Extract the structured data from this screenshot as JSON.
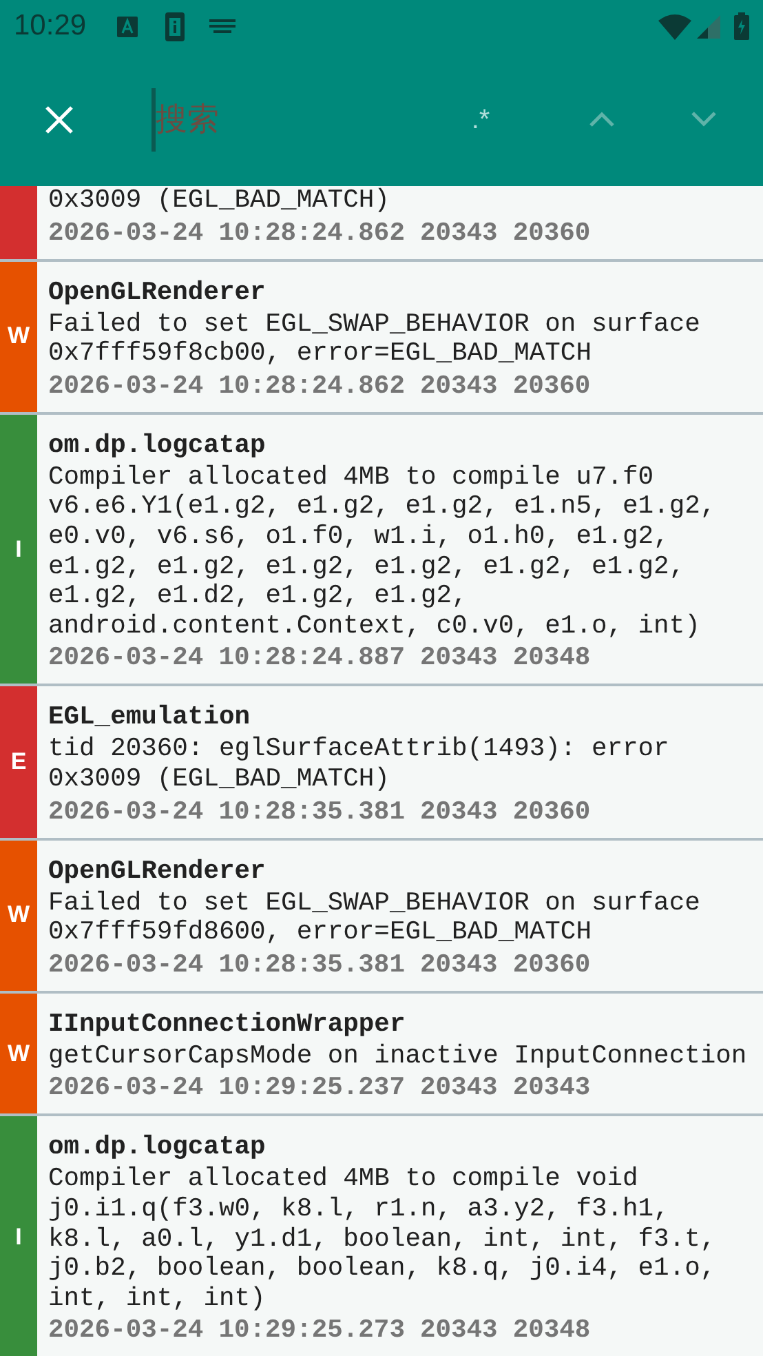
{
  "status_bar": {
    "time": "10:29"
  },
  "search": {
    "placeholder": "搜索",
    "regex_toggle": ".*",
    "prev_disabled": true,
    "next_disabled": true
  },
  "entries": [
    {
      "kind": "error",
      "message": "0x3009 (EGL_BAD_MATCH)",
      "date": "2026-03-24",
      "time": "10:28:24.862",
      "pid": "20343",
      "tid": "20360"
    },
    {
      "kind": "warn",
      "level": "W",
      "tag": "OpenGLRenderer",
      "message": "Failed to set EGL_SWAP_BEHAVIOR on surface 0x7fff59f8cb00, error=EGL_BAD_MATCH",
      "date": "2026-03-24",
      "time": "10:28:24.862",
      "pid": "20343",
      "tid": "20360"
    },
    {
      "kind": "info",
      "level": "I",
      "tag": "om.dp.logcatap",
      "message": "Compiler allocated 4MB to compile u7.f0 v6.e6.Y1(e1.g2, e1.g2, e1.g2, e1.n5, e1.g2, e0.v0, v6.s6, o1.f0, w1.i, o1.h0, e1.g2, e1.g2, e1.g2, e1.g2, e1.g2, e1.g2, e1.g2, e1.g2, e1.d2, e1.g2, e1.g2, android.content.Context, c0.v0, e1.o, int)",
      "date": "2026-03-24",
      "time": "10:28:24.887",
      "pid": "20343",
      "tid": "20348"
    },
    {
      "kind": "error",
      "level": "E",
      "tag": "EGL_emulation",
      "message": "tid 20360: eglSurfaceAttrib(1493): error 0x3009 (EGL_BAD_MATCH)",
      "date": "2026-03-24",
      "time": "10:28:35.381",
      "pid": "20343",
      "tid": "20360"
    },
    {
      "kind": "warn",
      "level": "W",
      "tag": "OpenGLRenderer",
      "message": "Failed to set EGL_SWAP_BEHAVIOR on surface 0x7fff59fd8600, error=EGL_BAD_MATCH",
      "date": "2026-03-24",
      "time": "10:28:35.381",
      "pid": "20343",
      "tid": "20360"
    },
    {
      "kind": "warn",
      "level": "W",
      "tag": "IInputConnectionWrapper",
      "message": "getCursorCapsMode on inactive InputConnection",
      "date": "2026-03-24",
      "time": "10:29:25.237",
      "pid": "20343",
      "tid": "20343"
    },
    {
      "kind": "info",
      "level": "I",
      "tag": "om.dp.logcatap",
      "message": "Compiler allocated 4MB to compile void j0.i1.q(f3.w0, k8.l, r1.n, a3.y2, f3.h1, k8.l, a0.l, y1.d1, boolean, int, int, f3.t, j0.b2, boolean, boolean, k8.q, j0.i4, e1.o, int, int, int)",
      "date": "2026-03-24",
      "time": "10:29:25.273",
      "pid": "20343",
      "tid": "20348"
    }
  ]
}
